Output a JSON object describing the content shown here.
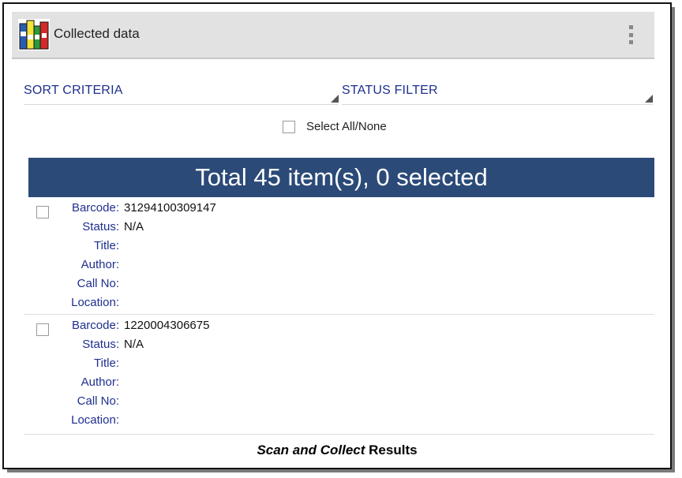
{
  "app": {
    "title": "Collected data"
  },
  "filters": {
    "sort_label": "SORT CRITERIA",
    "status_label": "STATUS FILTER"
  },
  "select_all": {
    "label": "Select All/None",
    "checked": false
  },
  "summary": {
    "text": "Total 45 item(s), 0 selected"
  },
  "field_labels": {
    "barcode": "Barcode:",
    "status": "Status:",
    "title": "Title:",
    "author": "Author:",
    "call_no": "Call No:",
    "location": "Location:"
  },
  "records": [
    {
      "barcode": "31294100309147",
      "status": "N/A",
      "title": "",
      "author": "",
      "call_no": "",
      "location": "",
      "checked": false
    },
    {
      "barcode": "1220004306675",
      "status": "N/A",
      "title": "",
      "author": "",
      "call_no": "",
      "location": "",
      "checked": false
    }
  ],
  "caption": {
    "emphasis": "Scan and Collect",
    "rest": " Results"
  },
  "colors": {
    "banner": "#2b4a78",
    "label_blue": "#1e2f8f",
    "actionbar": "#e2e2e2"
  },
  "icons": {
    "app": "books-icon",
    "overflow": "overflow-menu-icon"
  }
}
